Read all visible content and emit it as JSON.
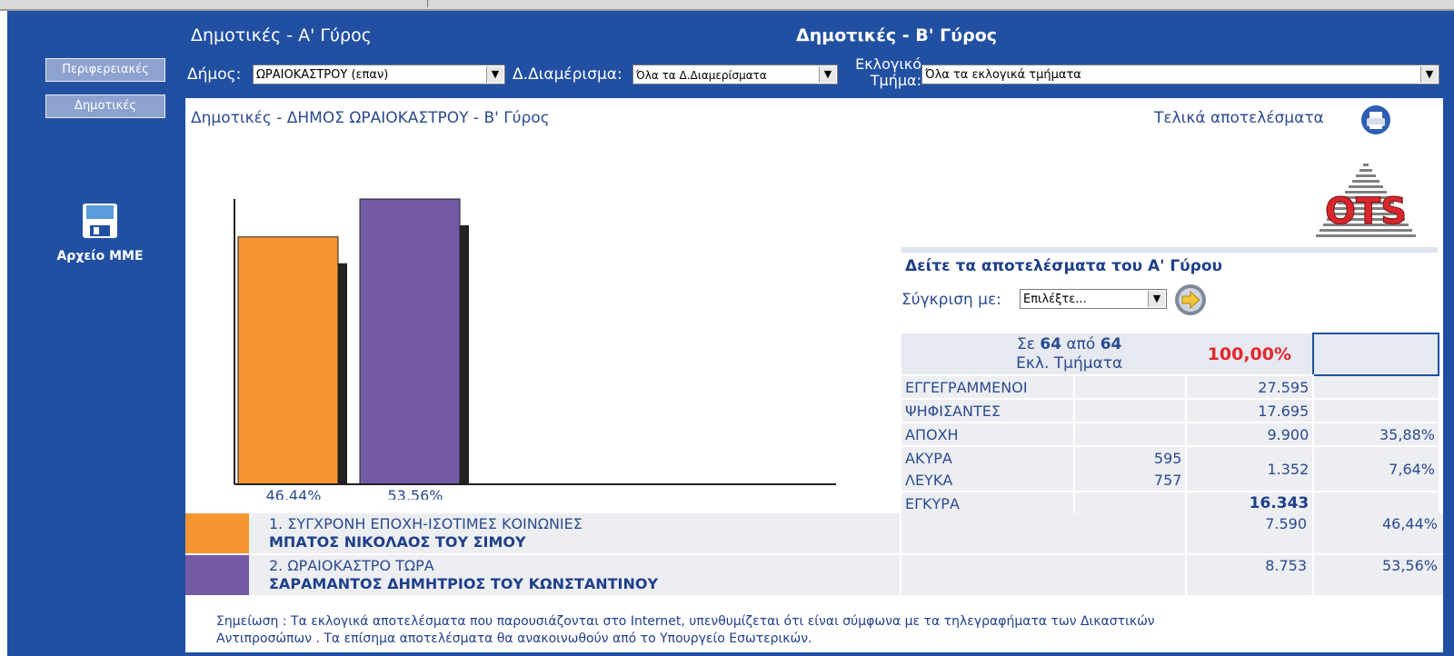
{
  "header": {
    "round_a_label": "Δημοτικές - Α' Γύρος",
    "round_b_label": "Δημοτικές - Β' Γύρος",
    "municipality_label": "Δήμος:",
    "municipality_value": "ΩΡΑΙΟΚΑΣΤΡΟΥ (επαν)",
    "district_label": "Δ.Διαμέρισμα:",
    "district_value": "Όλα τα Δ.Διαμερίσματα",
    "section_label_line1": "Εκλογικό",
    "section_label_line2": "Τμήμα:",
    "section_value": "Όλα τα εκλογικά τμήματα"
  },
  "sidebar": {
    "buttons": [
      {
        "label": "Περιφερειακές"
      },
      {
        "label": "Δημοτικές"
      }
    ],
    "archive_label": "Αρχείο ΜΜΕ"
  },
  "main": {
    "title": "Δημοτικές - ΔΗΜΟΣ ΩΡΑΙΟΚΑΣΤΡΟΥ - Β' Γύρος",
    "final_results": "Τελικά αποτελέσματα",
    "round_a_link": "Δείτε τα αποτελέσματα του Α' Γύρου",
    "compare_label": "Σύγκριση με:",
    "compare_value": "Επιλέξτε..."
  },
  "logo_text": "OTS",
  "summary": {
    "prefix": "Σε",
    "counted": "64",
    "of_word": "από",
    "total": "64",
    "sections_label": "Εκλ. Τμήματα",
    "percent": "100,00%",
    "rows": [
      {
        "label": "ΕΓΓΕΓΡΑΜΜΕΝΟΙ",
        "sub": "",
        "value": "27.595",
        "pct": ""
      },
      {
        "label": "ΨΗΦΙΣΑΝΤΕΣ",
        "sub": "",
        "value": "17.695",
        "pct": ""
      },
      {
        "label": "ΑΠΟΧΗ",
        "sub": "",
        "value": "9.900",
        "pct": "35,88%"
      },
      {
        "label": "ΑΚΥΡΑ",
        "sub": "595",
        "value": "1.352",
        "pct": "7,64%"
      },
      {
        "label": "ΛΕΥΚΑ",
        "sub": "757",
        "value": "",
        "pct": ""
      },
      {
        "label": "ΕΓΚΥΡΑ",
        "sub": "",
        "value": "16.343",
        "pct": ""
      }
    ]
  },
  "parties": [
    {
      "line1": "1. ΣΥΓΧΡΟΝΗ ΕΠΟΧΗ-ΙΣΟΤΙΜΕΣ ΚΟΙΝΩΝΙΕΣ",
      "line2": "ΜΠΑΤΟΣ ΝΙΚΟΛΑΟΣ ΤΟΥ ΣΙΜΟΥ",
      "votes": "7.590",
      "pct": "46,44%",
      "color": "#f59633"
    },
    {
      "line1": "2. ΩΡΑΙΟΚΑΣΤΡΟ ΤΩΡΑ",
      "line2": "ΣΑΡΑΜΑΝΤΟΣ ΔΗΜΗΤΡΙΟΣ ΤΟΥ ΚΩΝΣΤΑΝΤΙΝΟΥ",
      "votes": "8.753",
      "pct": "53,56%",
      "color": "#735aa4"
    }
  ],
  "chart_data": {
    "type": "bar",
    "categories": [
      "46,44%",
      "53,56%"
    ],
    "values": [
      46.44,
      53.56
    ],
    "colors": [
      "#f59633",
      "#735aa4"
    ],
    "ylim": [
      0,
      53.56
    ]
  },
  "note": {
    "line1": "Σημείωση : Τα εκλογικά αποτελέσματα που παρουσιάζονται στο Internet, υπενθυμίζεται ότι είναι σύμφωνα με τα τηλεγραφήματα των Δικαστικών",
    "line2": "Αντιπροσώπων . Τα επίσημα αποτελέσματα θα ανακοινωθούν από το Υπουργείο Εσωτερικών."
  },
  "colors": {
    "brand_blue": "#2150a3",
    "accent_red": "#e3262d"
  }
}
